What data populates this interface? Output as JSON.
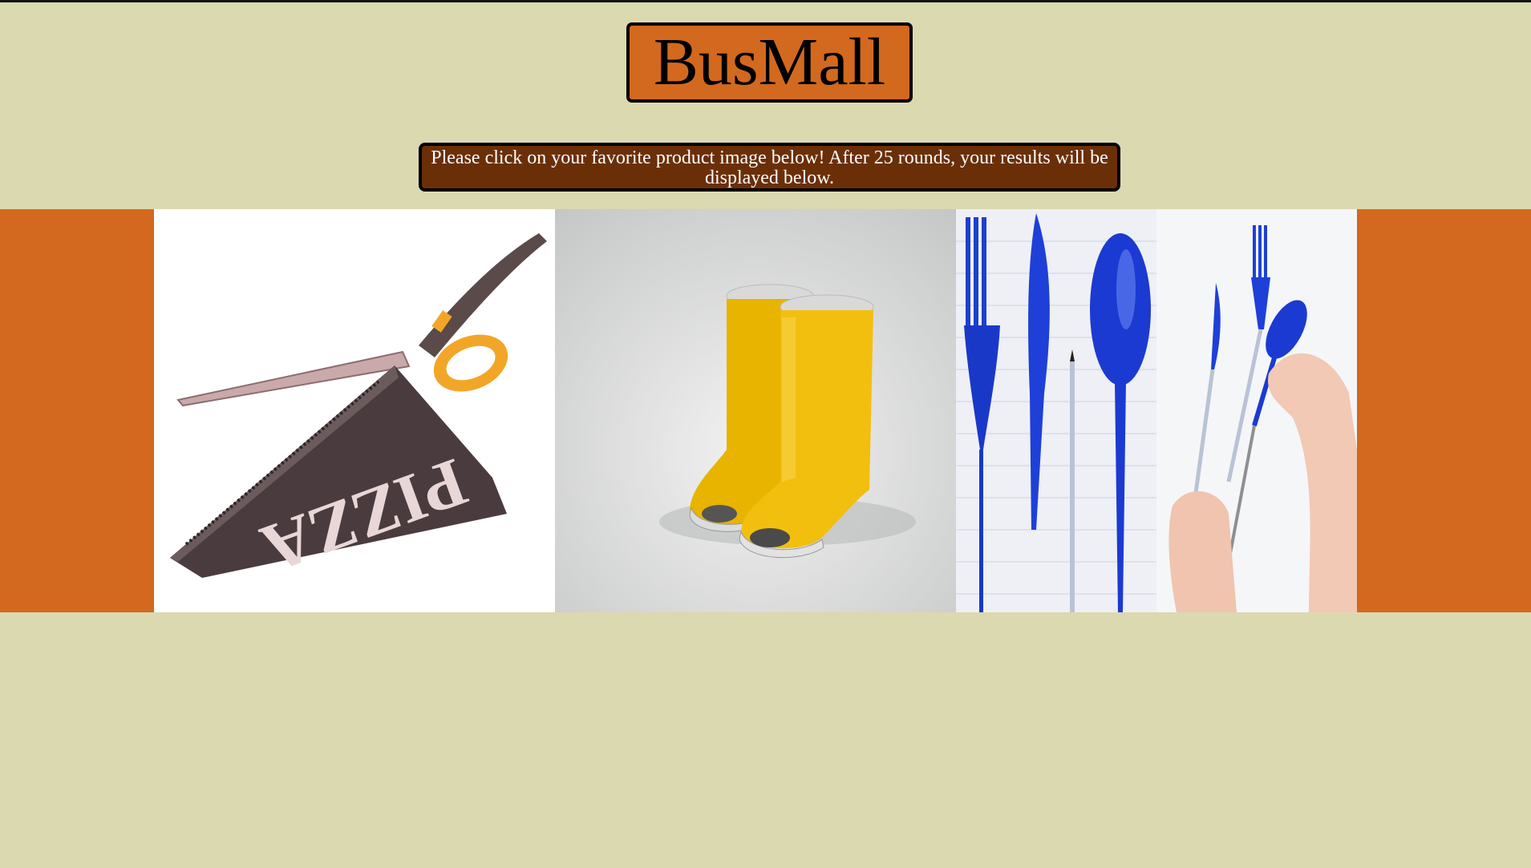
{
  "header": {
    "title": "BusMall"
  },
  "instructions": {
    "text": "Please click on your favorite product image below! After 25 rounds, your results will be displayed below."
  },
  "products": [
    {
      "icon": "pizza-scissors-image"
    },
    {
      "icon": "rain-boots-image"
    },
    {
      "icon": "pen-utensils-image"
    }
  ],
  "colors": {
    "background": "#DBD9AF",
    "title_bg": "#D2691E",
    "instructions_bg": "#6B2F08",
    "band": "#D2691E"
  }
}
